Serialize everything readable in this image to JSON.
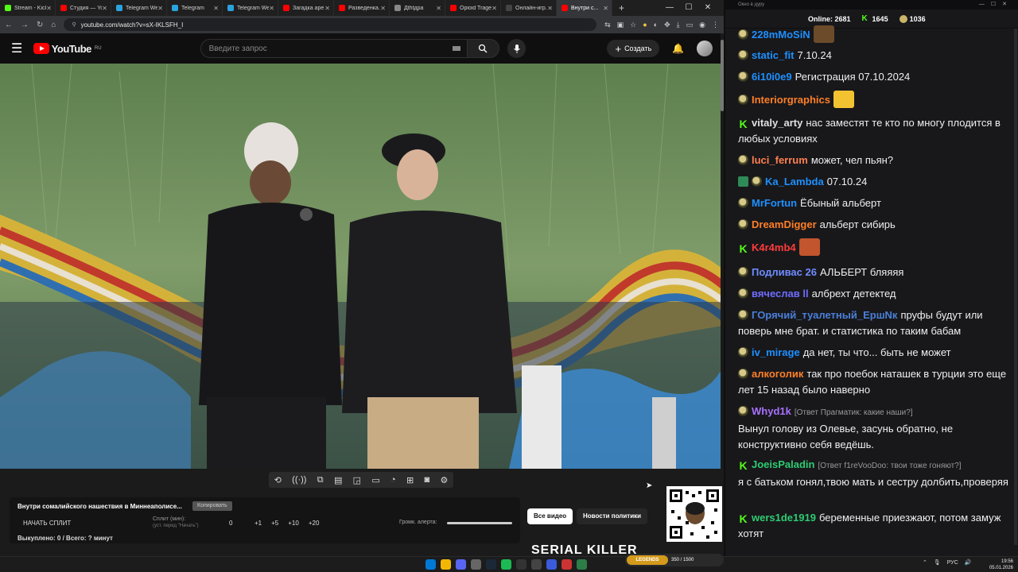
{
  "browser": {
    "tabs": [
      {
        "label": "Stream - Kick",
        "color": "#53fc18",
        "active": false
      },
      {
        "label": "Студия — YouTube",
        "color": "#ff0000",
        "active": false
      },
      {
        "label": "Telegram Web",
        "color": "#2aa3de",
        "active": false
      },
      {
        "label": "Telegram",
        "color": "#2aa3de",
        "active": false
      },
      {
        "label": "Telegram Web",
        "color": "#2aa3de",
        "active": false
      },
      {
        "label": "Загадка аре...",
        "color": "#ff0000",
        "active": false
      },
      {
        "label": "Разведенка...",
        "color": "#ff0000",
        "active": false
      },
      {
        "label": "Дthtдра",
        "color": "#888888",
        "active": false
      },
      {
        "label": "Opioid Trage...",
        "color": "#ff0000",
        "active": false
      },
      {
        "label": "Онлайн-игр...",
        "color": "#444444",
        "active": false
      },
      {
        "label": "Внутри с...",
        "color": "#ff0000",
        "active": true
      }
    ],
    "url": "youtube.com/watch?v=sX-IKLSFH_I"
  },
  "youtube": {
    "brand": "YouTube",
    "region": "RU",
    "search_placeholder": "Введите запрос",
    "create_label": "Создать",
    "notif_count": "9+"
  },
  "video": {
    "title": "Внутри сомалийского нашествия в Миннеаполисе...",
    "badge": "Копировать"
  },
  "split": {
    "start_label": "НАЧАТЬ СПЛИТ",
    "split_label": "Сплит (мин):",
    "split_hint": "(уст. перед \"Начать\")",
    "split_value": "0",
    "increments": [
      "+1",
      "+5",
      "+10",
      "+20"
    ],
    "volume_label": "Громк. алерта:",
    "volume_level": 1.0,
    "status_text": "Выкуплено: 0 / Всего: ? минут"
  },
  "chips": [
    "Все видео",
    "Новости политики"
  ],
  "thumbnail_text": "SERIAL KILLER",
  "chat": {
    "window_title": "Окно в дуру",
    "online_label": "Online:",
    "online_count": "2681",
    "stat1": "1645",
    "stat2": "1036",
    "messages": [
      {
        "badge": "guest",
        "nick": "228mMoSiN",
        "color": "#1e90ff",
        "text": "",
        "reply": "",
        "emote": "#6b4b2a"
      },
      {
        "badge": "guest",
        "nick": "static_fit",
        "color": "#1e90ff",
        "text": "7.10.24",
        "reply": "",
        "emote": ""
      },
      {
        "badge": "guest",
        "nick": "6i10i0e9",
        "color": "#1e90ff",
        "text": "Регистрация 07.10.2024",
        "reply": "",
        "emote": ""
      },
      {
        "badge": "guest",
        "nick": "Interiorgraphics",
        "color": "#ff7f27",
        "text": "",
        "reply": "",
        "emote": "#f2c230"
      },
      {
        "badge": "kick",
        "nick": "vitaly_arty",
        "color": "#e0e0e0",
        "text": "нас заместят те кто по многу плодится в любых условиях",
        "reply": "",
        "emote": ""
      },
      {
        "badge": "guest",
        "nick": "luci_ferrum",
        "color": "#ff7f50",
        "text": "может, чел пьян?",
        "reply": "",
        "emote": ""
      },
      {
        "badge": "mod",
        "nick": "Ka_Lambda",
        "color": "#1e90ff",
        "text": "07.10.24",
        "reply": "",
        "emote": ""
      },
      {
        "badge": "guest",
        "nick": "MrFortun",
        "color": "#1e90ff",
        "text": "Ёбыный альберт",
        "reply": "",
        "emote": ""
      },
      {
        "badge": "guest",
        "nick": "DreamDigger",
        "color": "#ff7f27",
        "text": "альберт сибирь",
        "reply": "",
        "emote": ""
      },
      {
        "badge": "kick",
        "nick": "K4r4mb4",
        "color": "#ff3b3b",
        "text": "",
        "reply": "",
        "emote": "#c2552e"
      },
      {
        "badge": "guest",
        "nick": "Подливас 26",
        "color": "#6f8cff",
        "text": "АЛЬБЕРТ бляяяя",
        "reply": "",
        "emote": ""
      },
      {
        "badge": "guest",
        "nick": "вячеслав ll",
        "color": "#6f6cff",
        "text": "албрехт детектед",
        "reply": "",
        "emote": ""
      },
      {
        "badge": "guest",
        "nick": "ГОрячий_туалетный_ЕршNк",
        "color": "#4a7fd8",
        "text": "пруфы будут или поверь мне брат. и статистика по таким бабам",
        "reply": "",
        "emote": ""
      },
      {
        "badge": "guest",
        "nick": "iv_mirage",
        "color": "#1e90ff",
        "text": "да нет, ты что... быть не может",
        "reply": "",
        "emote": ""
      },
      {
        "badge": "guest",
        "nick": "алкоголик",
        "color": "#ff7f27",
        "text": "так про поебок наташек в турции это еще лет 15 назад было наверно",
        "reply": "",
        "emote": ""
      },
      {
        "badge": "guest",
        "nick": "Whyd1k",
        "color": "#a970ff",
        "text": "Вынул голову из Олевье, засунь обратно, не конструктивно себя ведёшь.",
        "reply": "[Ответ Прагматик: какие наши?]",
        "emote": ""
      },
      {
        "badge": "kick",
        "nick": "JoeisPaladin",
        "color": "#2ecc71",
        "text": "я с батьком гонял,твою мать и сестру долбить,проверяя",
        "reply": "[Ответ f1reVooDoo: твои тоже гоняют?]",
        "emote": ""
      },
      {
        "badge": "kick",
        "nick": "wers1de1919",
        "color": "#2ecc71",
        "text": "беременные приезжают, потом замуж хотят",
        "reply": "",
        "emote": ""
      }
    ]
  },
  "taskbar": {
    "lang": "РУС",
    "time": "19:56",
    "date": "05.01.2026",
    "game_logo": "LEGENDS",
    "game_text": "350 / 1500"
  }
}
